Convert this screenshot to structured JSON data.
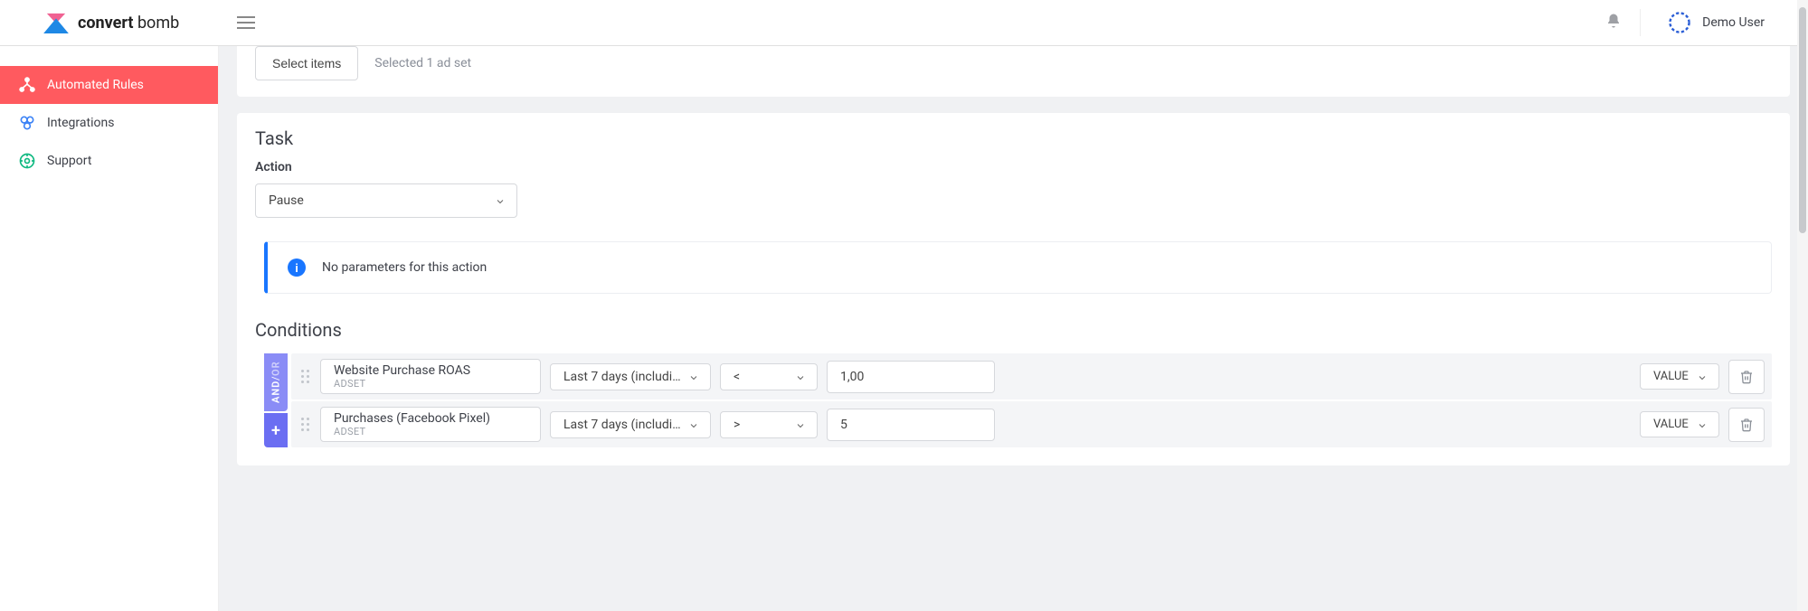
{
  "logo": {
    "bold": "convert",
    "light": "bomb"
  },
  "user": {
    "name": "Demo User"
  },
  "sidebar": {
    "items": [
      {
        "label": "Automated Rules"
      },
      {
        "label": "Integrations"
      },
      {
        "label": "Support"
      }
    ]
  },
  "top_card": {
    "select_button": "Select items",
    "selected_text": "Selected 1 ad set"
  },
  "task": {
    "title": "Task",
    "action_label": "Action",
    "action_value": "Pause",
    "info_message": "No parameters for this action"
  },
  "conditions": {
    "title": "Conditions",
    "and_label": "AND",
    "or_label": "OR",
    "plus_label": "+",
    "rows": [
      {
        "metric": "Website Purchase ROAS",
        "metric_sub": "ADSET",
        "period": "Last 7 days (includin...",
        "operator": "<",
        "value": "1,00",
        "value_type": "VALUE"
      },
      {
        "metric": "Purchases (Facebook Pixel)",
        "metric_sub": "ADSET",
        "period": "Last 7 days (includin...",
        "operator": ">",
        "value": "5",
        "value_type": "VALUE"
      }
    ]
  }
}
